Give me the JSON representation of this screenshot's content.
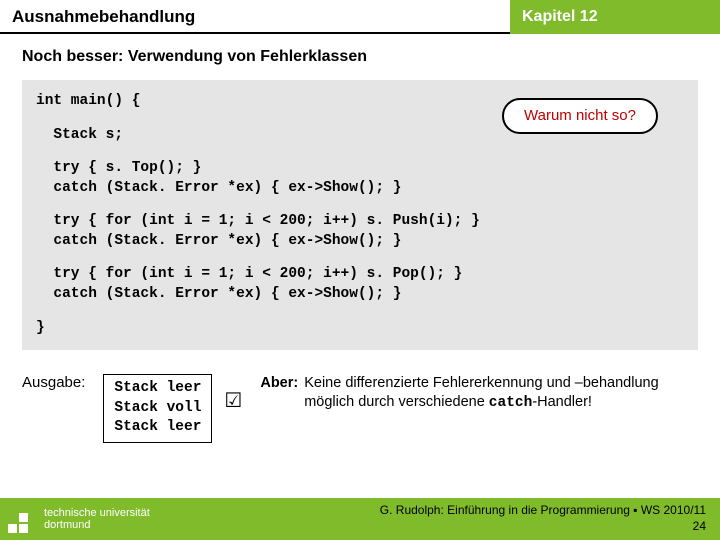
{
  "header": {
    "left": "Ausnahmebehandlung",
    "right": "Kapitel 12"
  },
  "subtitle": "Noch besser: Verwendung von Fehlerklassen",
  "code": {
    "l1": "int main() {",
    "l2": "  Stack s;",
    "l3": "  try { s. Top(); }",
    "l4": "  catch (Stack. Error *ex) { ex->Show(); }",
    "l5": "  try { for (int i = 1; i < 200; i++) s. Push(i); }",
    "l6": "  catch (Stack. Error *ex) { ex->Show(); }",
    "l7": "  try { for (int i = 1; i < 200; i++) s. Pop(); }",
    "l8": "  catch (Stack. Error *ex) { ex->Show(); }",
    "l9": "}"
  },
  "callout": "Warum nicht so?",
  "output": {
    "label": "Ausgabe:",
    "lines": {
      "a": "Stack leer",
      "b": "Stack voll",
      "c": "Stack leer"
    }
  },
  "check": "☑",
  "aber": {
    "label": "Aber:",
    "text1": "Keine differenzierte Fehlererkennung und –behandlung möglich durch verschiedene ",
    "catchword": "catch",
    "text2": "-Handler!"
  },
  "footer": {
    "uni1": "technische universität",
    "uni2": "dortmund",
    "credit": "G. Rudolph: Einführung in die Programmierung ▪ WS 2010/11",
    "page": "24"
  }
}
